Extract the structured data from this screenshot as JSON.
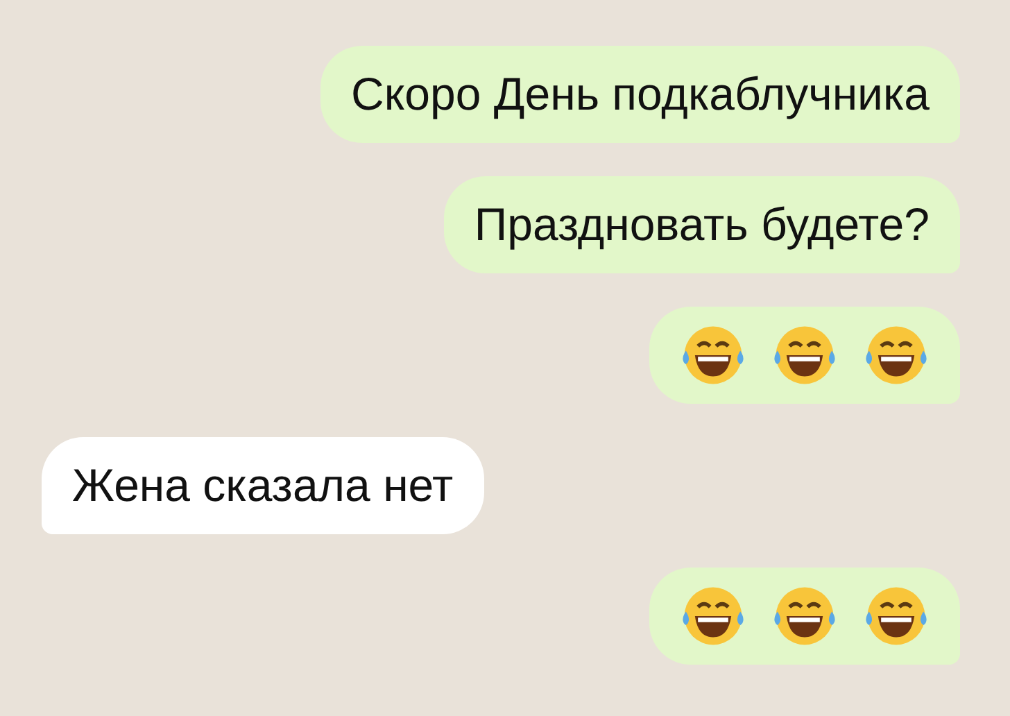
{
  "messages": [
    {
      "kind": "text",
      "outgoing": true,
      "text": "Скоро День подкаблучника"
    },
    {
      "kind": "text",
      "outgoing": true,
      "text": "Праздновать будете?"
    },
    {
      "kind": "emoji",
      "outgoing": true,
      "emojis": [
        {
          "kind": "tears-of-joy"
        },
        {
          "kind": "tears-of-joy"
        },
        {
          "kind": "tears-of-joy"
        }
      ]
    },
    {
      "kind": "text",
      "outgoing": false,
      "text": "Жена сказала нет"
    },
    {
      "kind": "emoji",
      "outgoing": true,
      "emojis": [
        {
          "kind": "tears-of-joy"
        },
        {
          "kind": "tears-of-joy"
        },
        {
          "kind": "tears-of-joy"
        }
      ]
    }
  ]
}
